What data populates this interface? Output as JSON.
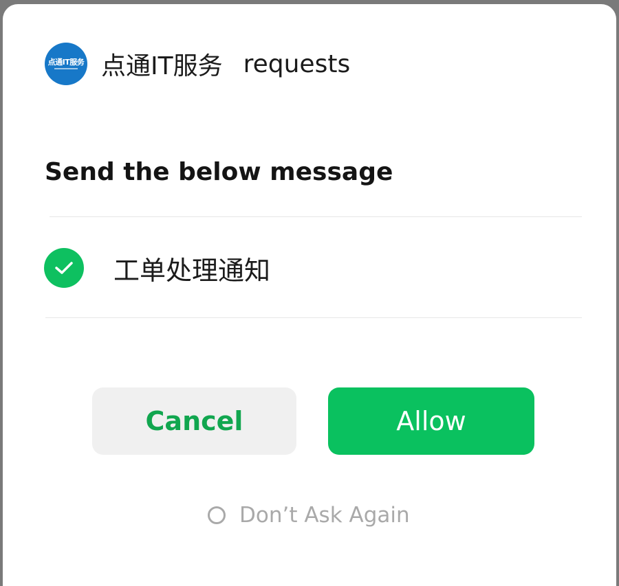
{
  "dialog": {
    "app_logo_text": "点通IT服务",
    "app_name": "点通IT服务",
    "requests_label": "requests",
    "title": "Send the below message",
    "message_item": {
      "label": "工单处理通知",
      "checked": true
    },
    "cancel_label": "Cancel",
    "allow_label": "Allow",
    "dont_ask_label": "Don’t Ask Again"
  },
  "colors": {
    "accent_green": "#0ac15f",
    "cancel_text_green": "#11a64f",
    "logo_blue": "#1778c8"
  }
}
